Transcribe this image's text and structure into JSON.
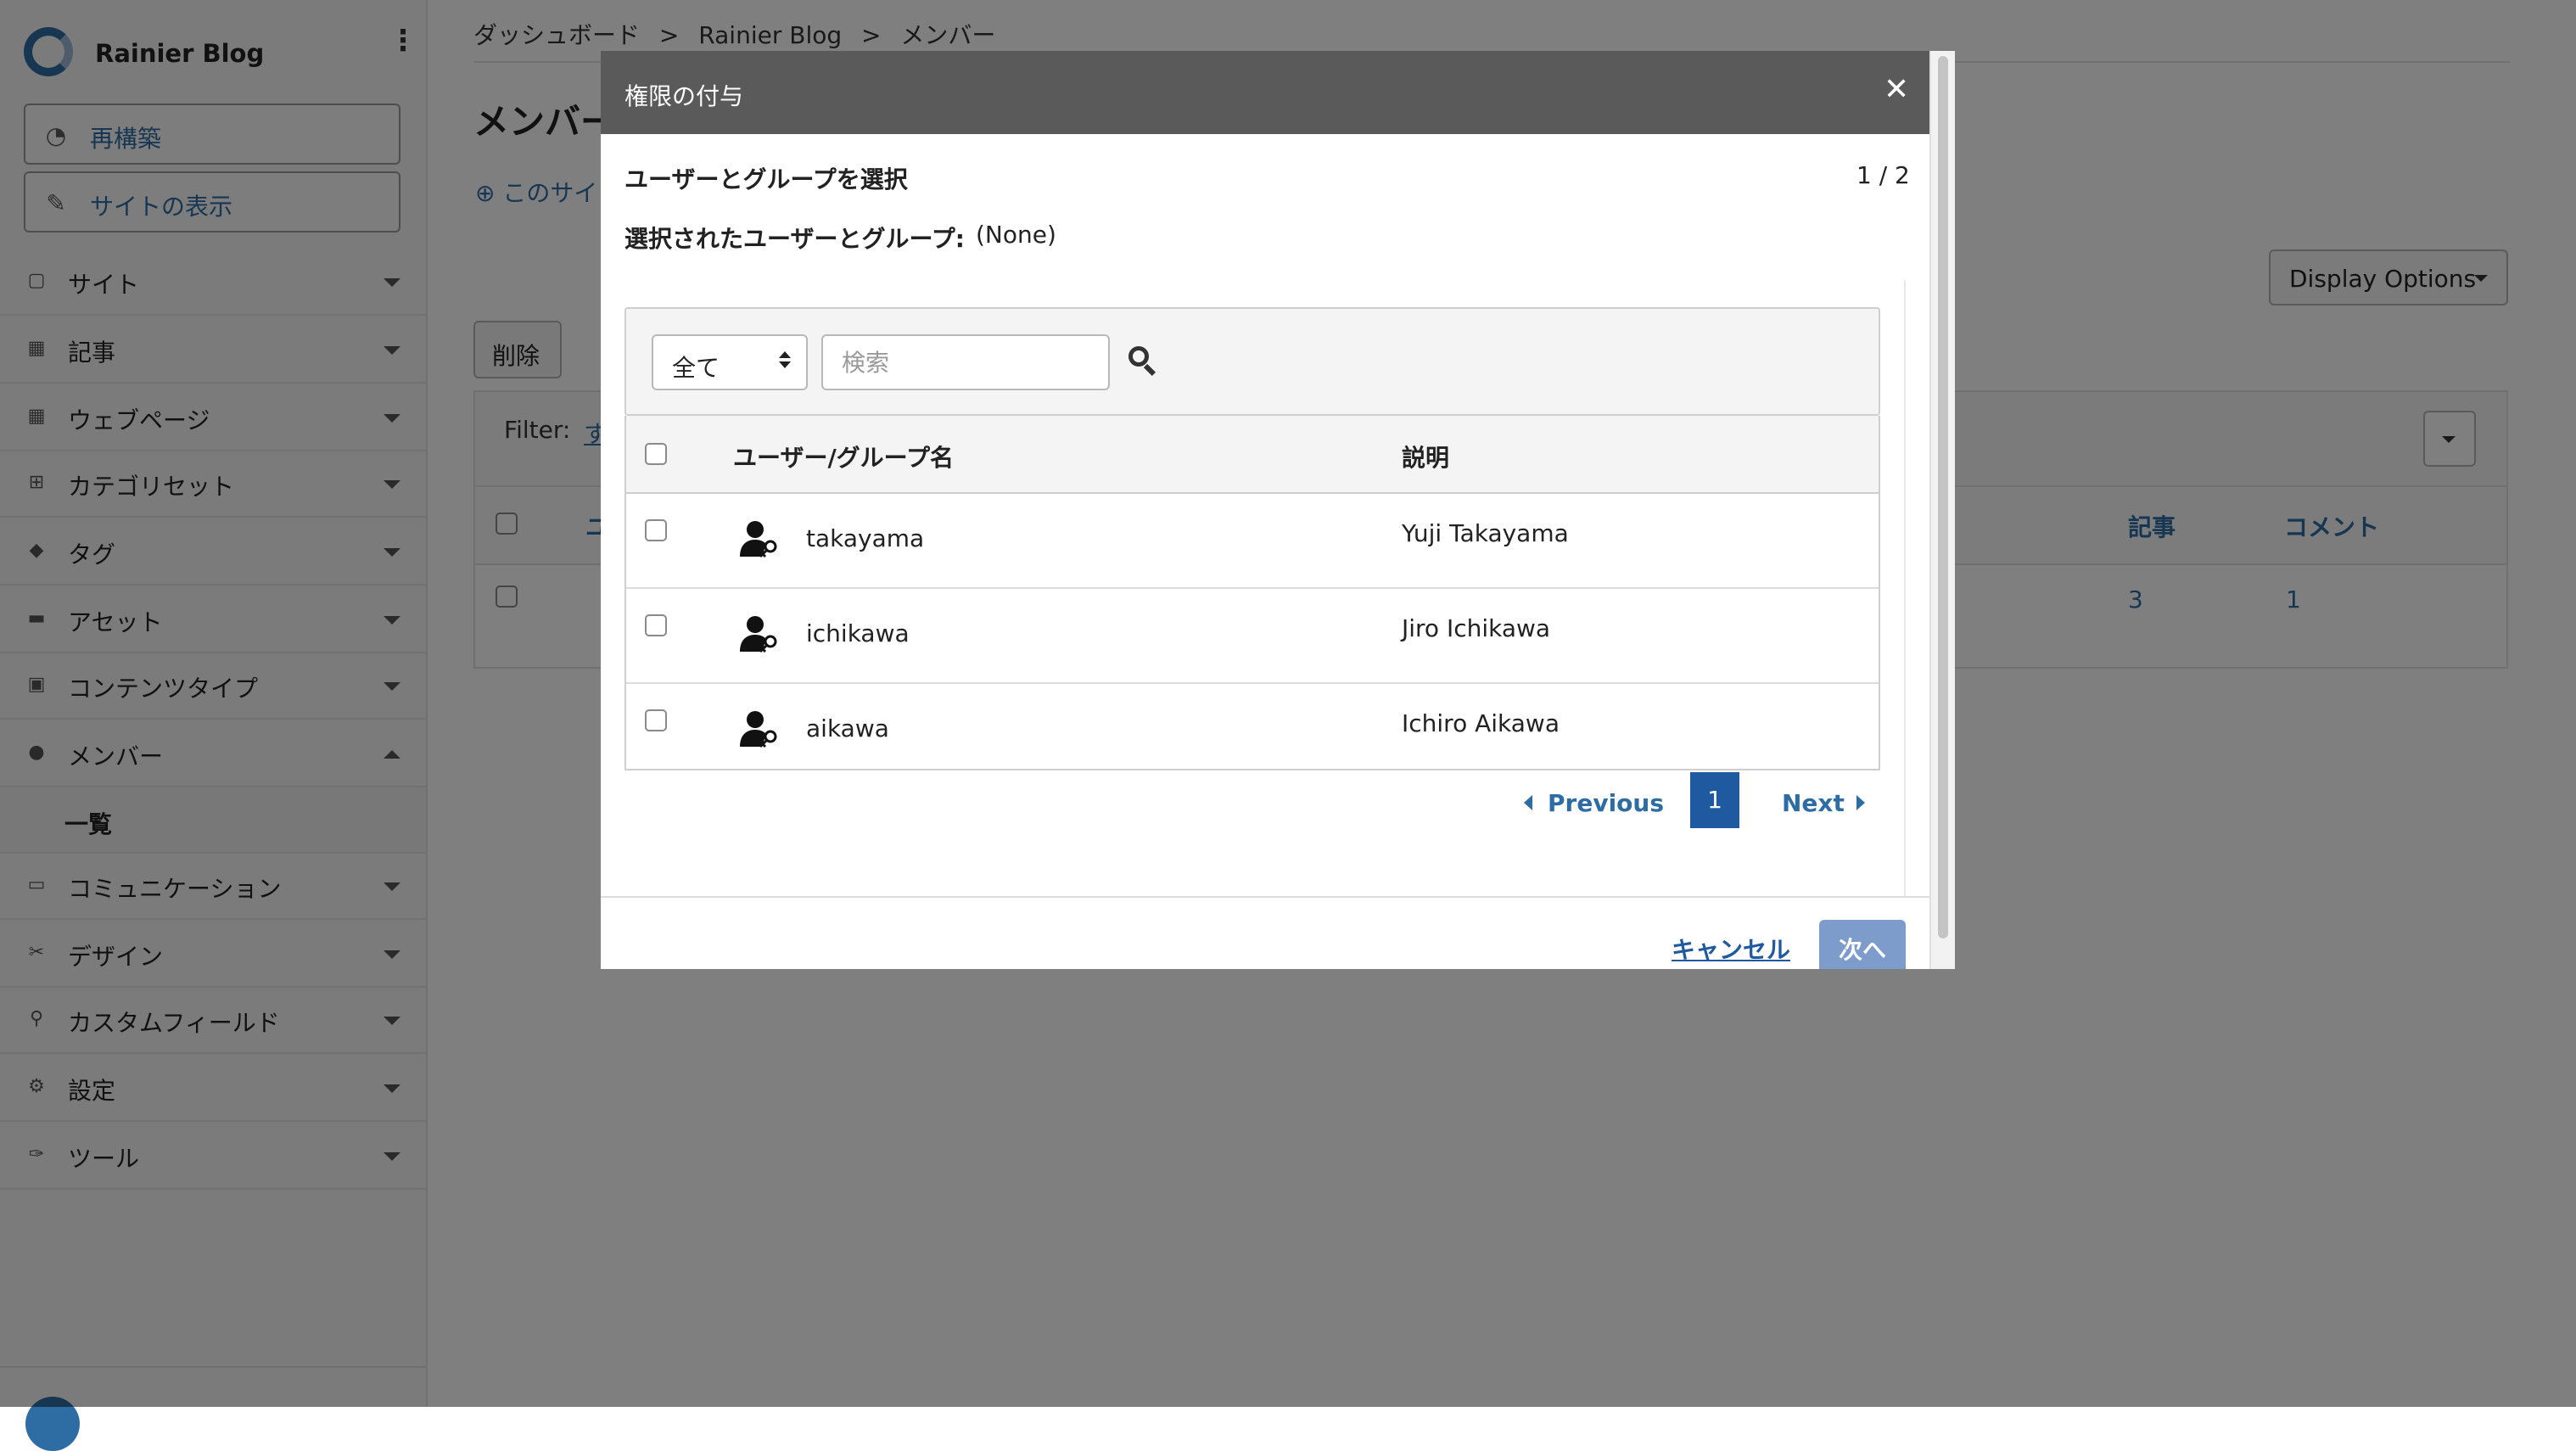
{
  "sidebar": {
    "site_name": "Rainier Blog",
    "rebuild_label": "再構築",
    "view_site_label": "サイトの表示",
    "items": [
      {
        "label": "サイト",
        "icon": "sites-icon"
      },
      {
        "label": "記事",
        "icon": "entries-icon"
      },
      {
        "label": "ウェブページ",
        "icon": "pages-icon"
      },
      {
        "label": "カテゴリセット",
        "icon": "category-sets-icon"
      },
      {
        "label": "タグ",
        "icon": "tag-icon"
      },
      {
        "label": "アセット",
        "icon": "assets-icon"
      },
      {
        "label": "コンテンツタイプ",
        "icon": "content-types-icon"
      },
      {
        "label": "メンバー",
        "icon": "member-icon"
      },
      {
        "label": "コミュニケーション",
        "icon": "communication-icon"
      },
      {
        "label": "デザイン",
        "icon": "design-icon"
      },
      {
        "label": "カスタムフィールド",
        "icon": "custom-fields-icon"
      },
      {
        "label": "設定",
        "icon": "gear-icon"
      },
      {
        "label": "ツール",
        "icon": "wrench-icon"
      }
    ],
    "sub_item": "一覧"
  },
  "main": {
    "breadcrumb": [
      "ダッシュボード",
      ">",
      "Rainier Blog",
      ">",
      "メンバー"
    ],
    "title": "メンバー",
    "add_link": "このサイ",
    "display_options": "Display Options",
    "delete_label": "削除",
    "filter_label": "Filter:",
    "filter_link": "す",
    "table": {
      "header_partial": "ユ",
      "col_entries": "記事",
      "col_comments": "コメント",
      "row": {
        "entries": "3",
        "comments": "1"
      }
    }
  },
  "modal": {
    "title": "権限の付与",
    "close_glyph": "✕",
    "step_title": "ユーザーとグループを選択",
    "step_count": "1 / 2",
    "selected_label": "選択されたユーザーとグループ:",
    "selected_value": "(None)",
    "filter_select_value": "全て",
    "search_placeholder": "検索",
    "table": {
      "col_name": "ユーザー/グループ名",
      "col_desc": "説明",
      "rows": [
        {
          "name": "takayama",
          "desc": "Yuji Takayama"
        },
        {
          "name": "ichikawa",
          "desc": "Jiro Ichikawa"
        },
        {
          "name": "aikawa",
          "desc": "Ichiro Aikawa"
        }
      ]
    },
    "pagination": {
      "previous": "Previous",
      "current": "1",
      "next": "Next"
    },
    "cancel_label": "キャンセル",
    "next_label": "次へ"
  },
  "colors": {
    "accent": "#2e6da4",
    "modal_header": "#5a5a5a",
    "page_active": "#1f5aa0",
    "next_button": "#7e9ccb"
  }
}
